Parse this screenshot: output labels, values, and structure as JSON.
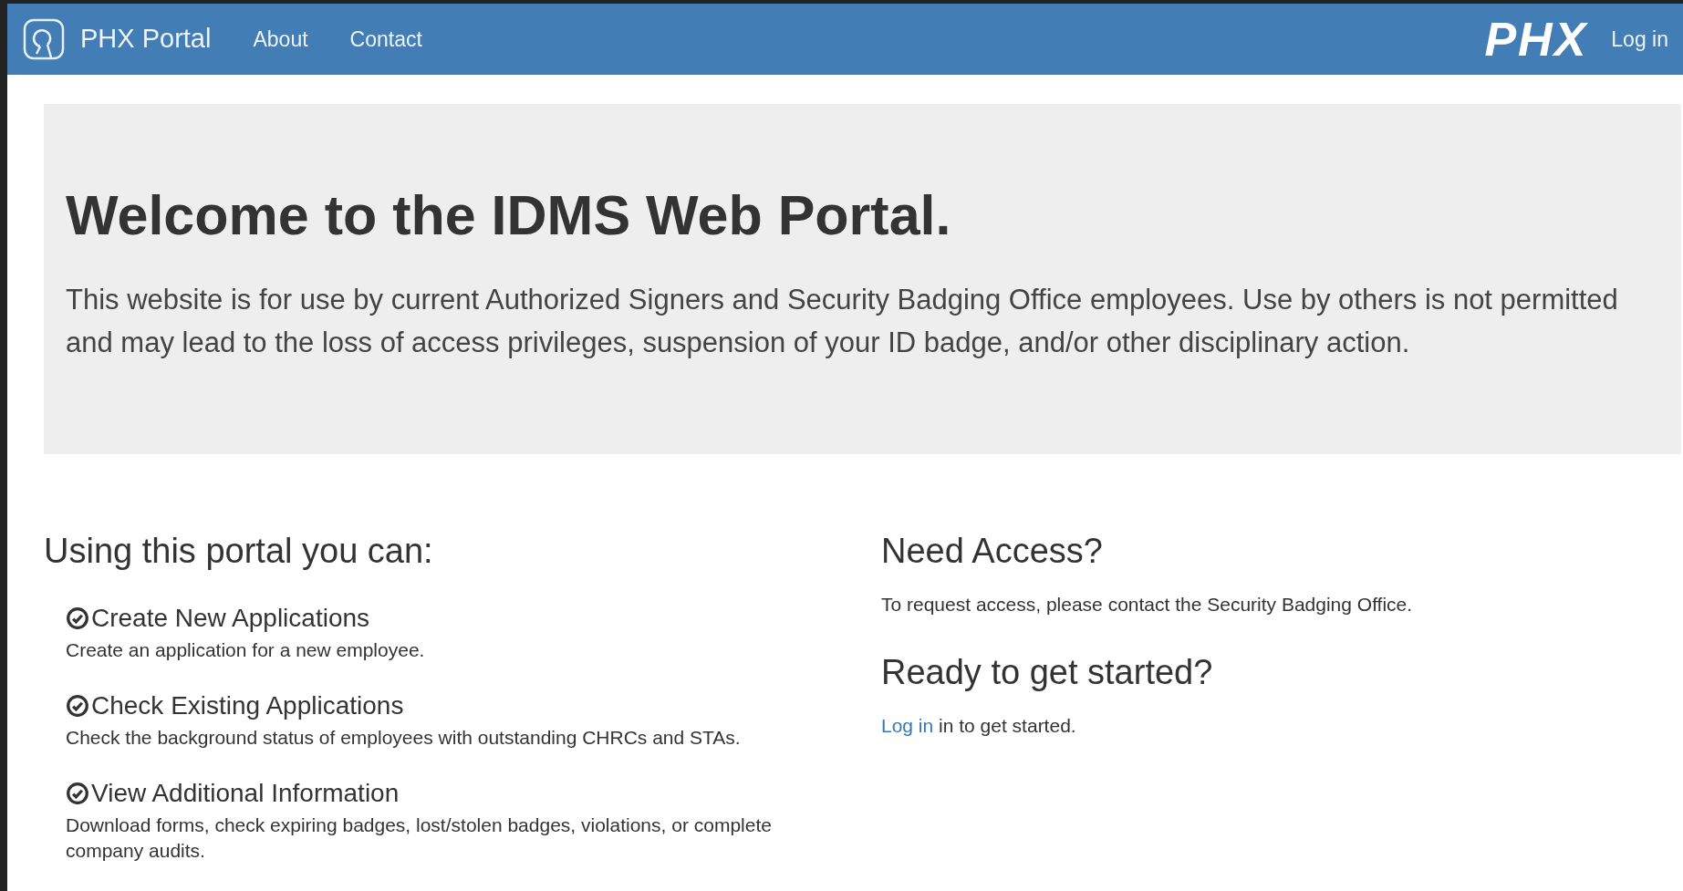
{
  "navbar": {
    "brand": "PHX Portal",
    "links": [
      {
        "label": "About"
      },
      {
        "label": "Contact"
      }
    ],
    "logo_text": "PHX",
    "login": "Log in"
  },
  "hero": {
    "title": "Welcome to the IDMS Web Portal.",
    "text": "This website is for use by current Authorized Signers and Security Badging Office employees. Use by others is not permitted and may lead to the loss of access privileges, suspension of your ID badge, and/or other disciplinary action."
  },
  "features": {
    "heading": "Using this portal you can:",
    "items": [
      {
        "title": "Create New Applications",
        "text": "Create an application for a new employee."
      },
      {
        "title": "Check Existing Applications",
        "text": "Check the background status of employees with outstanding CHRCs and STAs."
      },
      {
        "title": "View Additional Information",
        "text": "Download forms, check expiring badges, lost/stolen badges, violations, or complete company audits."
      }
    ]
  },
  "access": {
    "heading": "Need Access?",
    "text": "To request access, please contact the Security Badging Office."
  },
  "start": {
    "heading": "Ready to get started?",
    "link": "Log in",
    "text": "in to get started."
  }
}
